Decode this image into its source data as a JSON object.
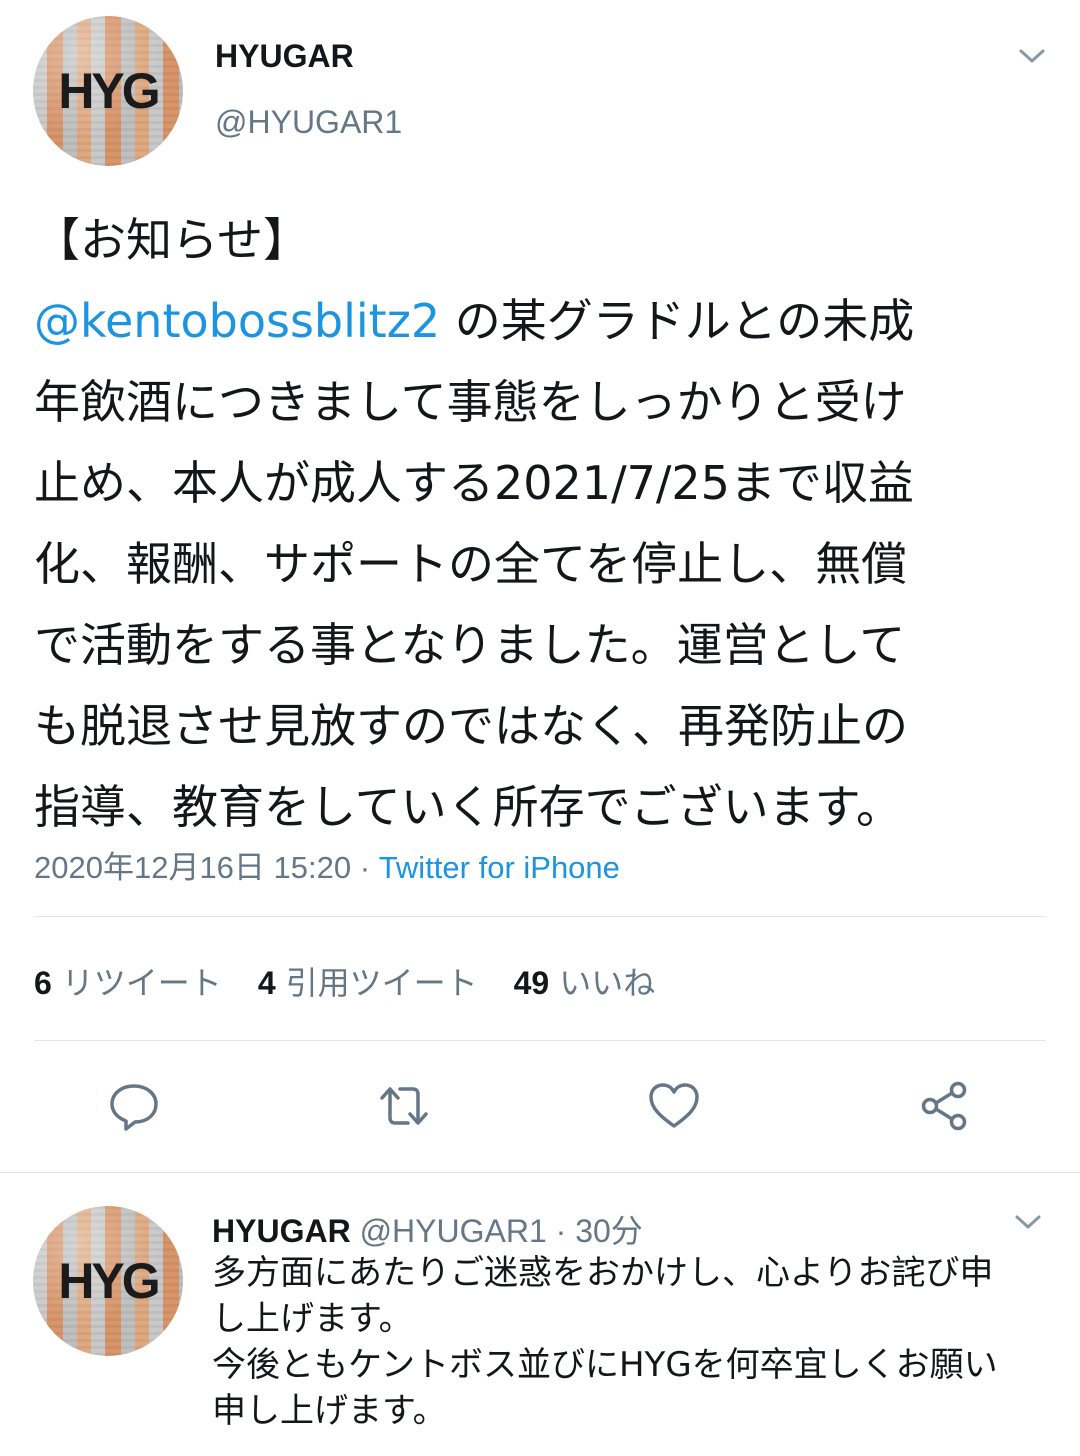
{
  "tweet": {
    "author_name": "HYUGAR",
    "author_handle": "@HYUGAR1",
    "avatar_text": "HYG",
    "heading": "【お知らせ】",
    "mention": "@kentobossblitz2",
    "body_rest": " の某グラドルとの未成\n年飲酒につきまして事態をしっかりと受け\n止め、本人が成人する2021/7/25まで収益\n化、報酬、サポートの全てを停止し、無償\nで活動をする事となりました。運営として\nも脱退させ見放すのではなく、再発防止の\n指導、教育をしていく所存でございます。",
    "timestamp": "2020年12月16日 15:20",
    "separator": " · ",
    "source": "Twitter for iPhone",
    "stats": {
      "retweets_count": "6",
      "retweets_label": "リツイート",
      "quotes_count": "4",
      "quotes_label": "引用ツイート",
      "likes_count": "49",
      "likes_label": "いいね"
    },
    "icons": [
      "reply-icon",
      "retweet-icon",
      "like-icon",
      "share-icon",
      "chevron-down-icon"
    ]
  },
  "reply": {
    "author_name": "HYUGAR",
    "author_handle": "@HYUGAR1",
    "time": " · 30分",
    "avatar_text": "HYG",
    "text": "多方面にあたりご迷惑をおかけし、心よりお詫び申\nし上げます。\n今後ともケントボス並びにHYGを何卒宜しくお願い\n申し上げます。"
  },
  "colors": {
    "link": "#1b95e0",
    "secondary_text": "#657786",
    "divider": "#e1e8ed"
  }
}
